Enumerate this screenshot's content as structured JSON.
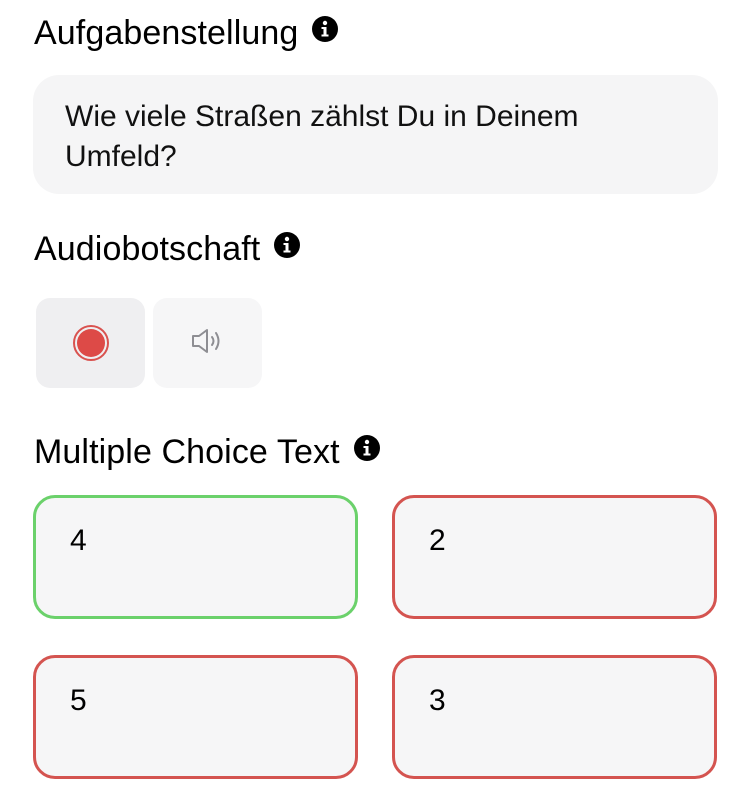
{
  "task": {
    "title": "Aufgabenstellung",
    "text": "Wie viele Straßen zählst Du in Deinem Umfeld?"
  },
  "audio": {
    "title": "Audiobotschaft",
    "record_icon": "record-icon",
    "play_icon": "speaker-icon"
  },
  "multiple_choice": {
    "title": "Multiple Choice Text",
    "options": [
      {
        "label": "4",
        "state": "correct",
        "color": "#6bd16b"
      },
      {
        "label": "2",
        "state": "incorrect",
        "color": "#d45450"
      },
      {
        "label": "5",
        "state": "incorrect",
        "color": "#d45450"
      },
      {
        "label": "3",
        "state": "incorrect",
        "color": "#d45450"
      }
    ]
  },
  "colors": {
    "correct": "#6bd16b",
    "incorrect": "#d45450",
    "record": "#dd4a47",
    "field_background": "#f5f5f6"
  }
}
